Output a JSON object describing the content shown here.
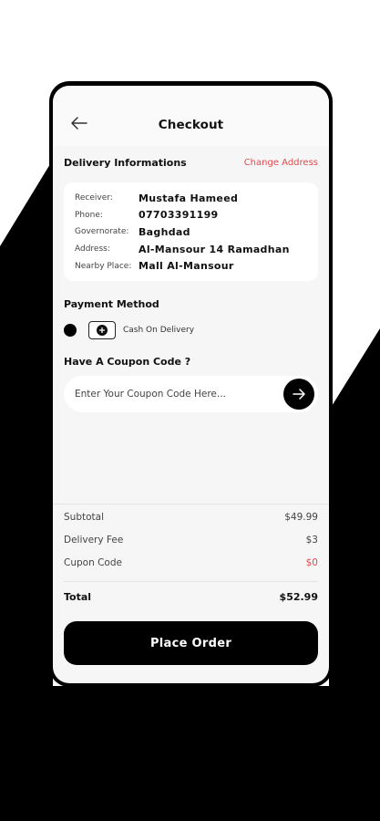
{
  "header": {
    "title": "Checkout",
    "back_icon": "arrow-left-icon"
  },
  "delivery": {
    "title": "Delivery Informations",
    "change_label": "Change Address",
    "fields": [
      {
        "label": "Receiver:",
        "value": "Mustafa Hameed"
      },
      {
        "label": "Phone:",
        "value": "07703391199"
      },
      {
        "label": "Governorate:",
        "value": "Baghdad"
      },
      {
        "label": "Address:",
        "value": "Al-Mansour 14 Ramadhan"
      },
      {
        "label": "Nearby Place:",
        "value": "Mall Al-Mansour"
      }
    ]
  },
  "payment": {
    "title": "Payment Method",
    "option_label": "Cash On Delivery",
    "icon": "cash-icon"
  },
  "coupon": {
    "title": "Have A Coupon Code ?",
    "placeholder": "Enter Your Coupon Code Here...",
    "value": "",
    "submit_icon": "arrow-right-icon"
  },
  "summary": {
    "subtotal_label": "Subtotal",
    "subtotal_value": "$49.99",
    "delivery_label": "Delivery Fee",
    "delivery_value": "$3",
    "coupon_label": "Cupon Code",
    "coupon_value": "$0",
    "total_label": "Total",
    "total_value": "$52.99"
  },
  "actions": {
    "place_order_label": "Place Order"
  },
  "colors": {
    "accent": "#e5484d",
    "primary": "#000000",
    "surface": "#f6f6f6"
  }
}
